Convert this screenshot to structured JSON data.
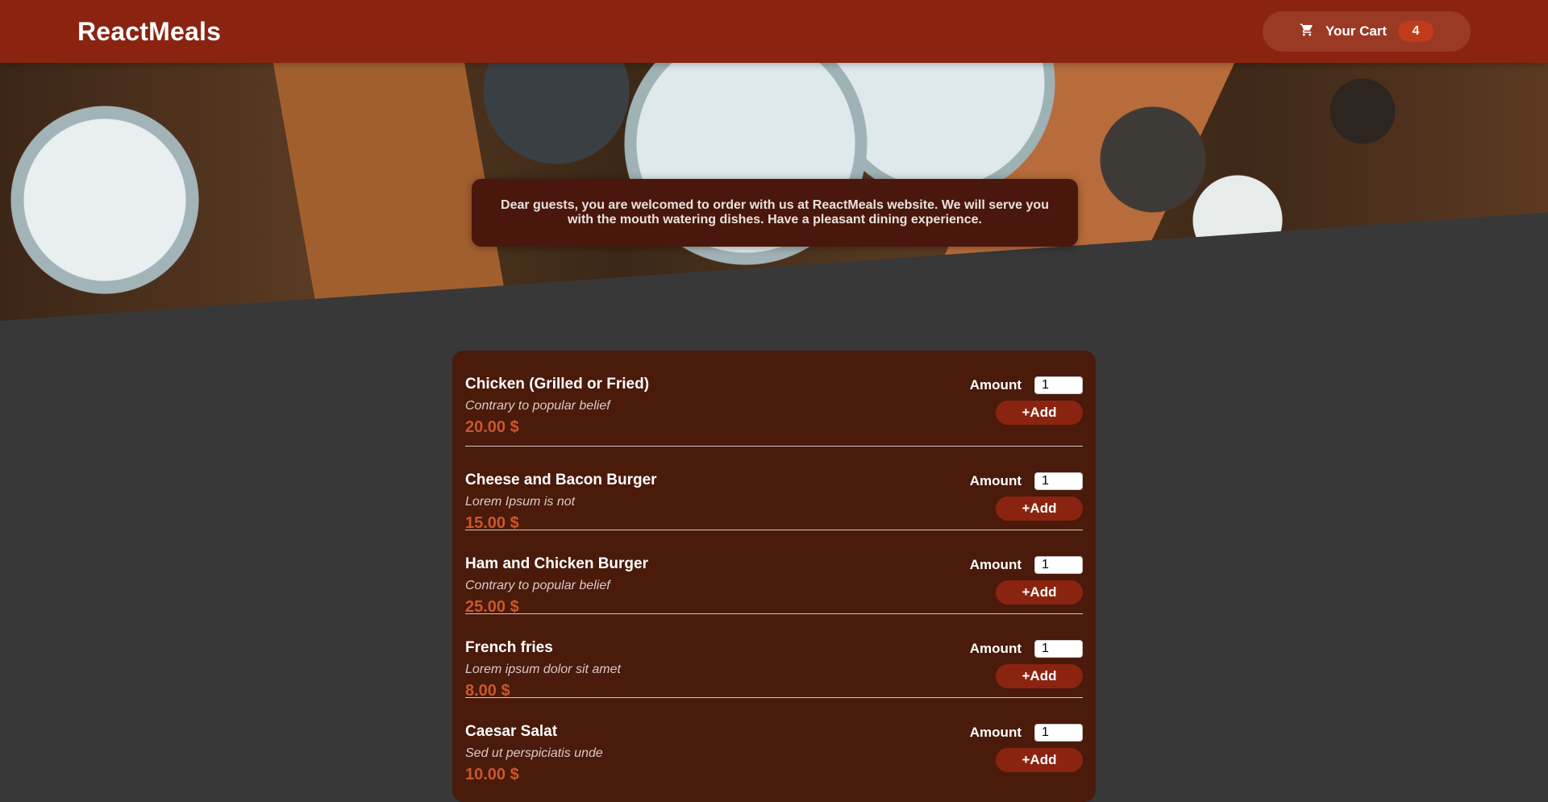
{
  "header": {
    "brand": "ReactMeals",
    "cart_label": "Your Cart",
    "cart_count": "4",
    "cart_icon": "cart-icon"
  },
  "hero": {
    "welcome_text": "Dear guests, you are welcomed to order with us at ReactMeals website. We will serve you with the mouth watering dishes. Have a pleasant dining experience."
  },
  "meals": [
    {
      "name": "Chicken (Grilled or Fried)",
      "description": "Contrary to popular belief",
      "price": "20.00 $",
      "amount_label": "Amount",
      "amount_value": "1",
      "add_label": "+Add"
    },
    {
      "name": "Cheese and Bacon Burger",
      "description": "Lorem Ipsum is not",
      "price": "15.00 $",
      "amount_label": "Amount",
      "amount_value": "1",
      "add_label": "+Add"
    },
    {
      "name": "Ham and Chicken Burger",
      "description": "Contrary to popular belief",
      "price": "25.00 $",
      "amount_label": "Amount",
      "amount_value": "1",
      "add_label": "+Add"
    },
    {
      "name": "French fries",
      "description": "Lorem ipsum dolor sit amet",
      "price": "8.00 $",
      "amount_label": "Amount",
      "amount_value": "1",
      "add_label": "+Add"
    },
    {
      "name": "Caesar Salat",
      "description": "Sed ut perspiciatis unde",
      "price": "10.00 $",
      "amount_label": "Amount",
      "amount_value": "1",
      "add_label": "+Add"
    }
  ],
  "colors": {
    "header_bg": "#8a2410",
    "page_bg": "#383838",
    "card_bg": "#4a1a0b",
    "price": "#c9582c",
    "button": "#8a2410"
  }
}
